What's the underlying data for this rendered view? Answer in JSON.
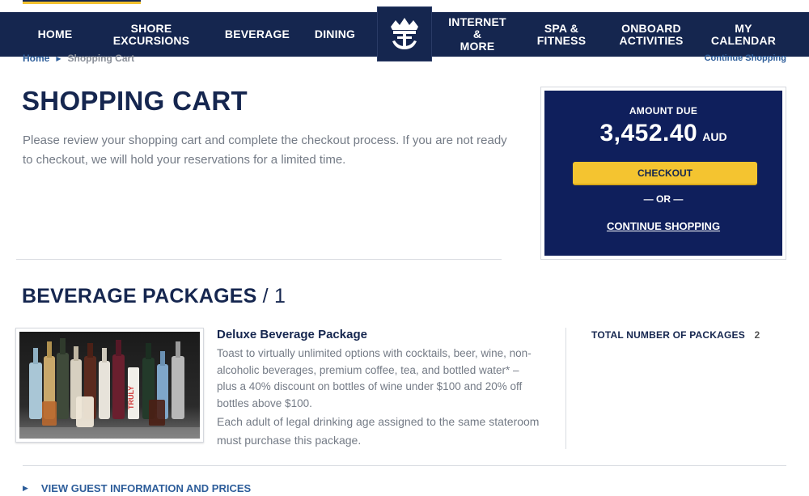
{
  "nav": {
    "items": [
      {
        "label": "HOME"
      },
      {
        "label": "SHORE EXCURSIONS"
      },
      {
        "label": "BEVERAGE"
      },
      {
        "label": "DINING"
      },
      {
        "label_line1": "INTERNET &",
        "label_line2": "MORE"
      },
      {
        "label_line1": "SPA &",
        "label_line2": "FITNESS"
      },
      {
        "label_line1": "ONBOARD",
        "label_line2": "ACTIVITIES"
      },
      {
        "label_line1": "MY",
        "label_line2": "CALENDAR"
      }
    ],
    "logo_icon": "crown-anchor-icon"
  },
  "breadcrumb": {
    "home": "Home",
    "current": "Shopping Cart",
    "continue_link": "Continue Shopping"
  },
  "page": {
    "title": "SHOPPING CART",
    "intro": "Please review your shopping cart and complete the checkout process. If you are not ready to checkout, we will hold your reservations for a limited time."
  },
  "summary": {
    "amount_label": "AMOUNT DUE",
    "amount": "3,452.40",
    "currency": "AUD",
    "checkout_label": "CHECKOUT",
    "or_label": "— OR —",
    "continue_label": "CONTINUE SHOPPING"
  },
  "section": {
    "title": "BEVERAGE PACKAGES",
    "count": "/ 1"
  },
  "package": {
    "name": "Deluxe Beverage Package",
    "description": "Toast to virtually unlimited options with cocktails, beer, wine, non-alcoholic beverages, premium coffee, tea, and bottled water* – plus a 40% discount on bottles of wine under $100 and 20% off bottles above $100.",
    "note": "Each adult of legal drinking age assigned to the same stateroom must purchase this package.",
    "total_label": "TOTAL NUMBER OF PACKAGES",
    "total_value": "2",
    "image_label": "TRULY"
  },
  "footer": {
    "view_guest_label": "VIEW GUEST INFORMATION AND PRICES"
  },
  "colors": {
    "navy": "#15264f",
    "summary_bg": "#0f1f5c",
    "checkout_yellow": "#f4c430",
    "link_blue": "#2d5d9a",
    "body_gray": "#747b86"
  }
}
